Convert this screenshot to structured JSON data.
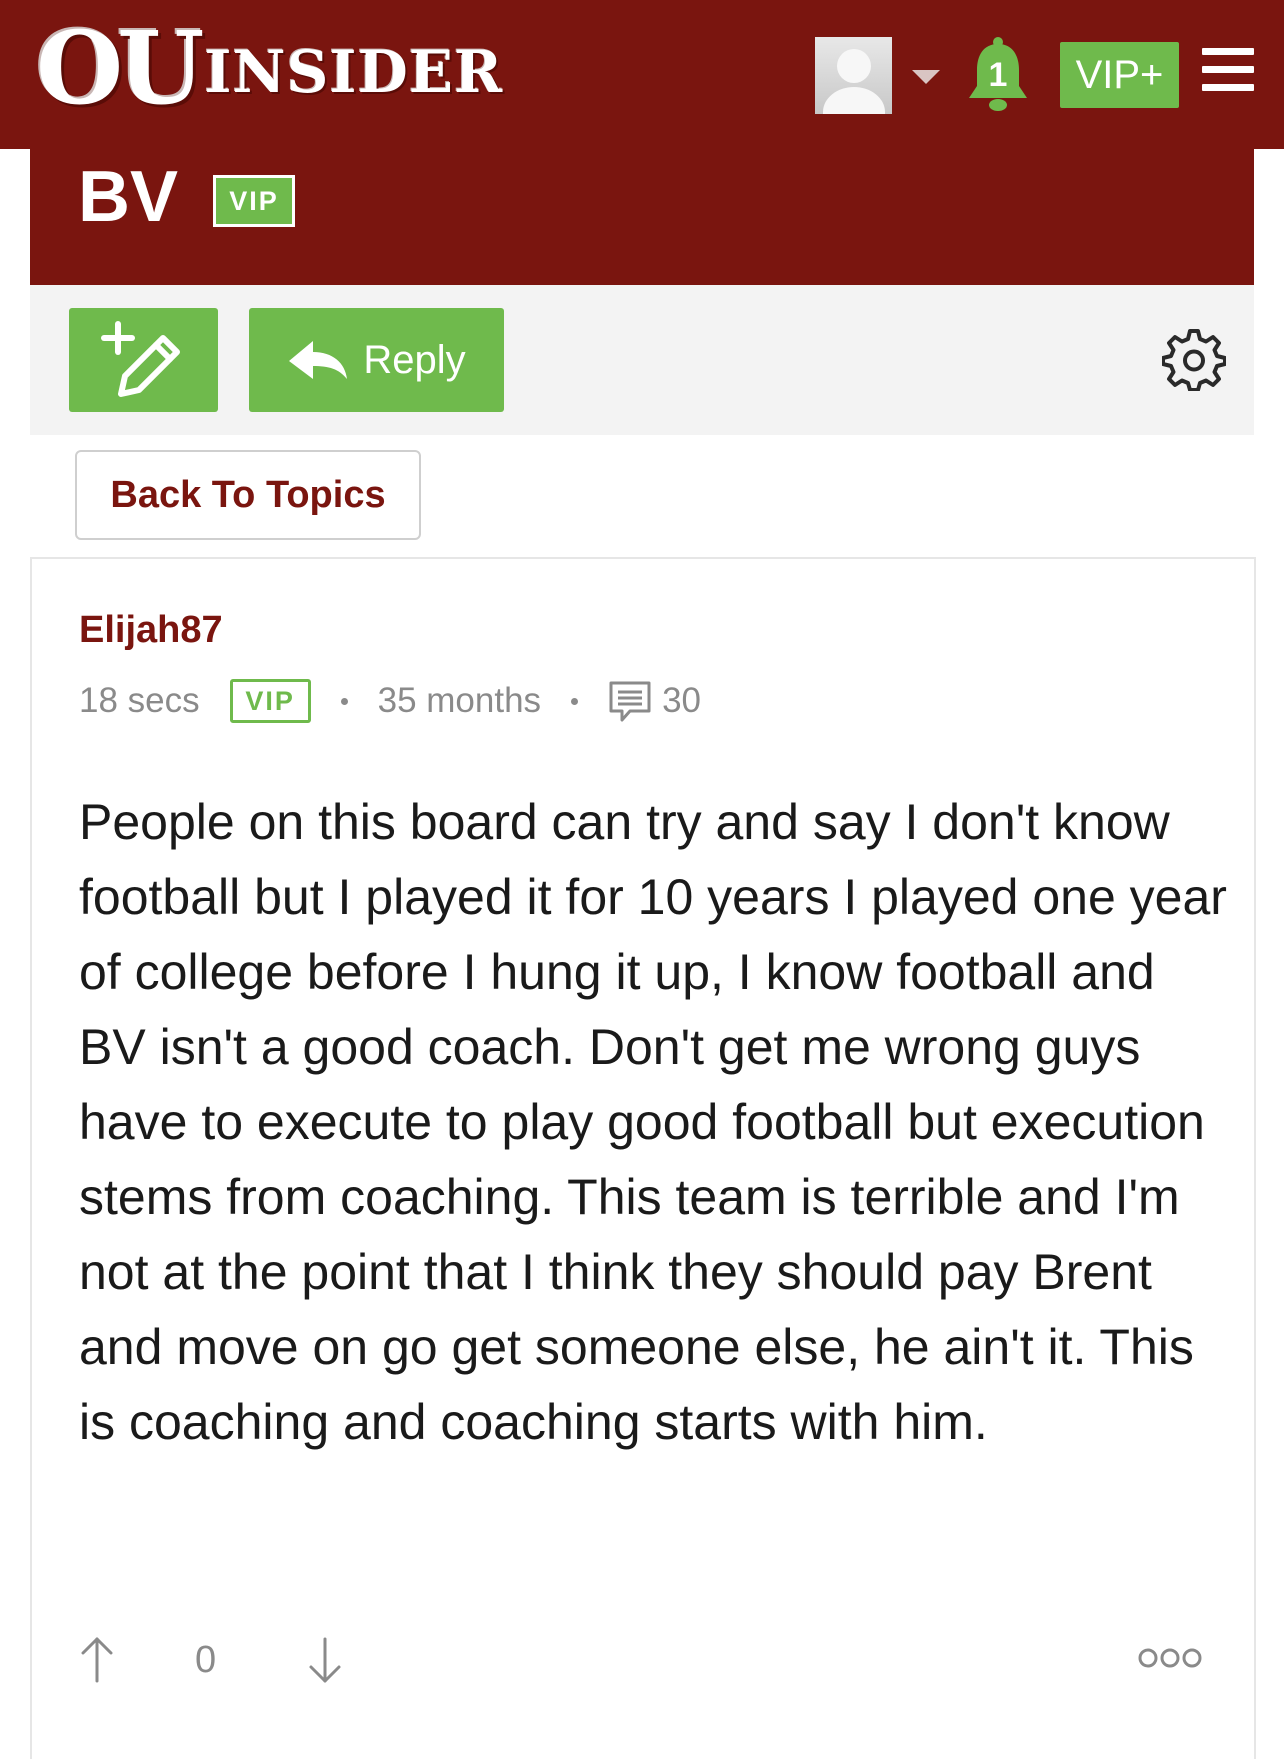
{
  "header": {
    "logo_ou": "OU",
    "logo_insider": "INSIDER",
    "notification_count": "1",
    "vip_plus_label": "VIP+",
    "brand_color": "#7a150f",
    "accent_color": "#6fba4c"
  },
  "thread": {
    "title": "BV",
    "vip_badge": "VIP"
  },
  "actions": {
    "reply_label": "Reply",
    "back_label": "Back To Topics",
    "new_topic_icon": "pencil-plus-icon",
    "settings_icon": "gear-icon"
  },
  "post": {
    "author": "Elijah87",
    "time_ago": "18 secs",
    "vip_badge": "VIP",
    "member_for": "35 months",
    "comment_count": "30",
    "body": "People on this board can try and say I don't know football but I played it for 10 years I played one year of college before I hung it up, I know football and BV isn't a good coach. Don't get me wrong guys have to execute to play good football but execution stems from coaching. This team is terrible and I'm not at the point that I think they should pay Brent and move on go get someone else, he ain't it. This is coaching and coaching starts with him.",
    "vote_count": "0"
  }
}
